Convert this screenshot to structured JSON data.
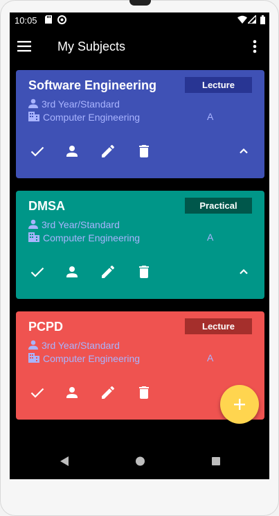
{
  "status_bar": {
    "time": "10:05",
    "left_icons": [
      "sd-card-icon",
      "sync-icon"
    ],
    "right_icons": [
      "wifi-icon",
      "signal-icon",
      "battery-icon"
    ]
  },
  "app_bar": {
    "title": "My Subjects",
    "menu_icon": "hamburger-menu-icon",
    "more_icon": "more-vertical-icon"
  },
  "subjects": [
    {
      "name": "Software Engineering",
      "type": "Lecture",
      "year": "3rd Year/Standard",
      "department": "Computer Engineering",
      "section": "A",
      "color": "#3f51b5",
      "badge_color": "#283593",
      "expanded": true
    },
    {
      "name": "DMSA",
      "type": "Practical",
      "year": "3rd Year/Standard",
      "department": "Computer Engineering",
      "section": "A",
      "color": "#009688",
      "badge_color": "#00574b",
      "expanded": true
    },
    {
      "name": "PCPD",
      "type": "Lecture",
      "year": "3rd Year/Standard",
      "department": "Computer Engineering",
      "section": "A",
      "color": "#ef5350",
      "badge_color": "#a52f2c",
      "expanded": false
    }
  ],
  "card_actions": [
    "check-icon",
    "person-icon",
    "edit-pencil-icon",
    "delete-icon",
    "expand-less-icon"
  ],
  "fab": {
    "icon": "plus-icon",
    "color": "#ffd54f"
  },
  "nav_bar": [
    "back-icon",
    "home-icon",
    "recents-icon"
  ]
}
